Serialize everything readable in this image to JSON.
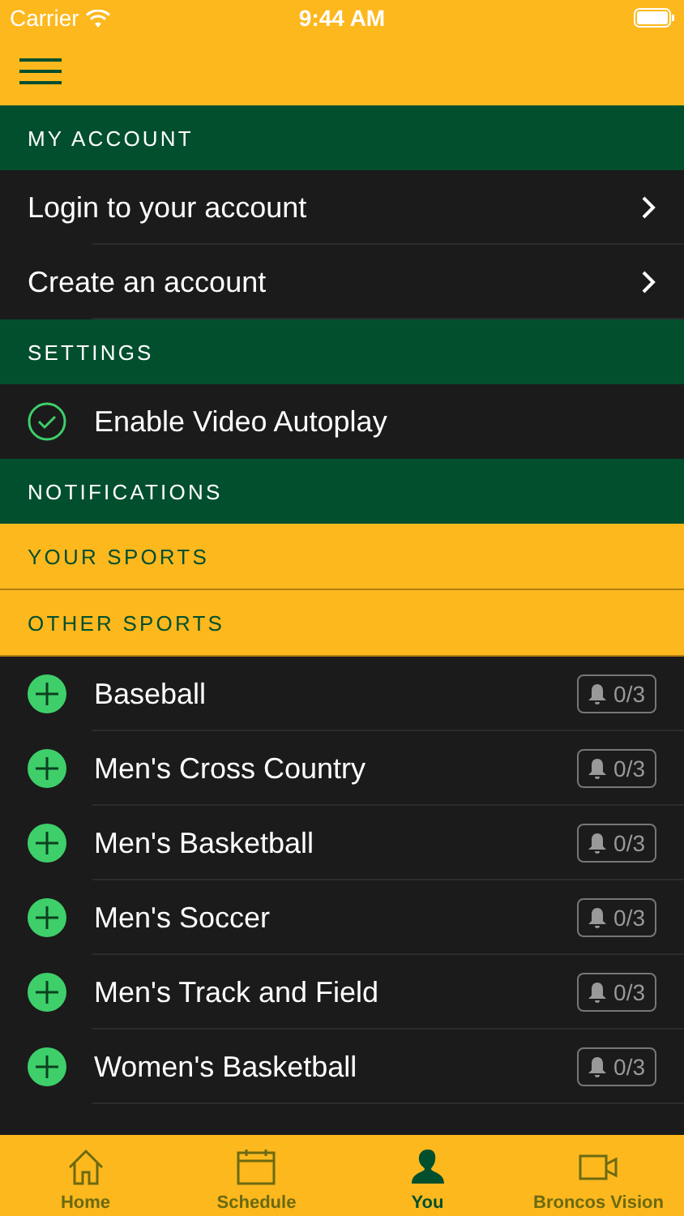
{
  "status_bar": {
    "carrier": "Carrier",
    "time": "9:44 AM"
  },
  "sections": [
    {
      "title": "MY ACCOUNT",
      "kind": "header",
      "items": [
        {
          "kind": "link",
          "label": "Login to your account"
        },
        {
          "kind": "link",
          "label": "Create an account"
        }
      ]
    },
    {
      "title": "SETTINGS",
      "kind": "header",
      "items": [
        {
          "kind": "toggle",
          "label": "Enable Video Autoplay",
          "checked": true
        }
      ]
    },
    {
      "title": "NOTIFICATIONS",
      "kind": "header"
    },
    {
      "title": "YOUR SPORTS",
      "kind": "subheader"
    },
    {
      "title": "OTHER SPORTS",
      "kind": "subheader",
      "items": [
        {
          "kind": "sport",
          "label": "Baseball",
          "count": "0/3"
        },
        {
          "kind": "sport",
          "label": "Men's Cross Country",
          "count": "0/3"
        },
        {
          "kind": "sport",
          "label": "Men's Basketball",
          "count": "0/3"
        },
        {
          "kind": "sport",
          "label": "Men's Soccer",
          "count": "0/3"
        },
        {
          "kind": "sport",
          "label": "Men's Track and Field",
          "count": "0/3"
        },
        {
          "kind": "sport",
          "label": "Women's Basketball",
          "count": "0/3"
        }
      ]
    }
  ],
  "tabs": [
    {
      "label": "Home",
      "kind": "home",
      "selected": false
    },
    {
      "label": "Schedule",
      "kind": "calendar",
      "selected": false
    },
    {
      "label": "You",
      "kind": "person",
      "selected": true
    },
    {
      "label": "Broncos Vision",
      "kind": "video",
      "selected": false
    }
  ]
}
